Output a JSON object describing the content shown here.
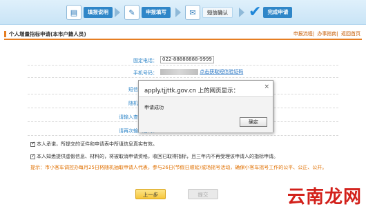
{
  "steps": [
    {
      "label": "填报说明",
      "icon": "document-icon"
    },
    {
      "label": "申报填写",
      "icon": "edit-icon"
    },
    {
      "label": "短信确认",
      "icon": "message-icon",
      "active": true
    },
    {
      "label": "完成申请",
      "icon": "check-icon"
    }
  ],
  "title": "个人增量指标申请(本市户籍人员)",
  "top_links": [
    "申报流程",
    "办事指南",
    "返回首页"
  ],
  "form": {
    "fixed_phone_label": "固定电话：",
    "fixed_phone_value": "022-88888888-9999",
    "mobile_label": "手机号码：",
    "get_code_link": "点击获取短信验证码",
    "sms_code_label": "短信验证码：",
    "random_seq_label": "随机顺序码：",
    "query_pwd_label": "请输入查询密码：",
    "query_pwd_again_label": "请再次输入密码："
  },
  "commitments": [
    "本人承诺，所提交的证件和申请表中所填信息真实有效。",
    "本人知悉提供虚假信息、材料的，将被取消申请资格，收回已取得指标，且三年内不再受理该申请人的指标申请。"
  ],
  "tip": "提示：市小客车调控办每月25日将随机抽取申请人代表，参与26日(节假日顺延)或场摇号活动，确保小客车摇号工作的公平、公正、公开。",
  "buttons": {
    "prev": "上一步",
    "submit": "提交"
  },
  "dialog": {
    "title": "apply.tjjttk.gov.cn 上的网页显示：",
    "close": "×",
    "message": "申请成功",
    "ok": "确定"
  },
  "watermark": "云南龙网"
}
